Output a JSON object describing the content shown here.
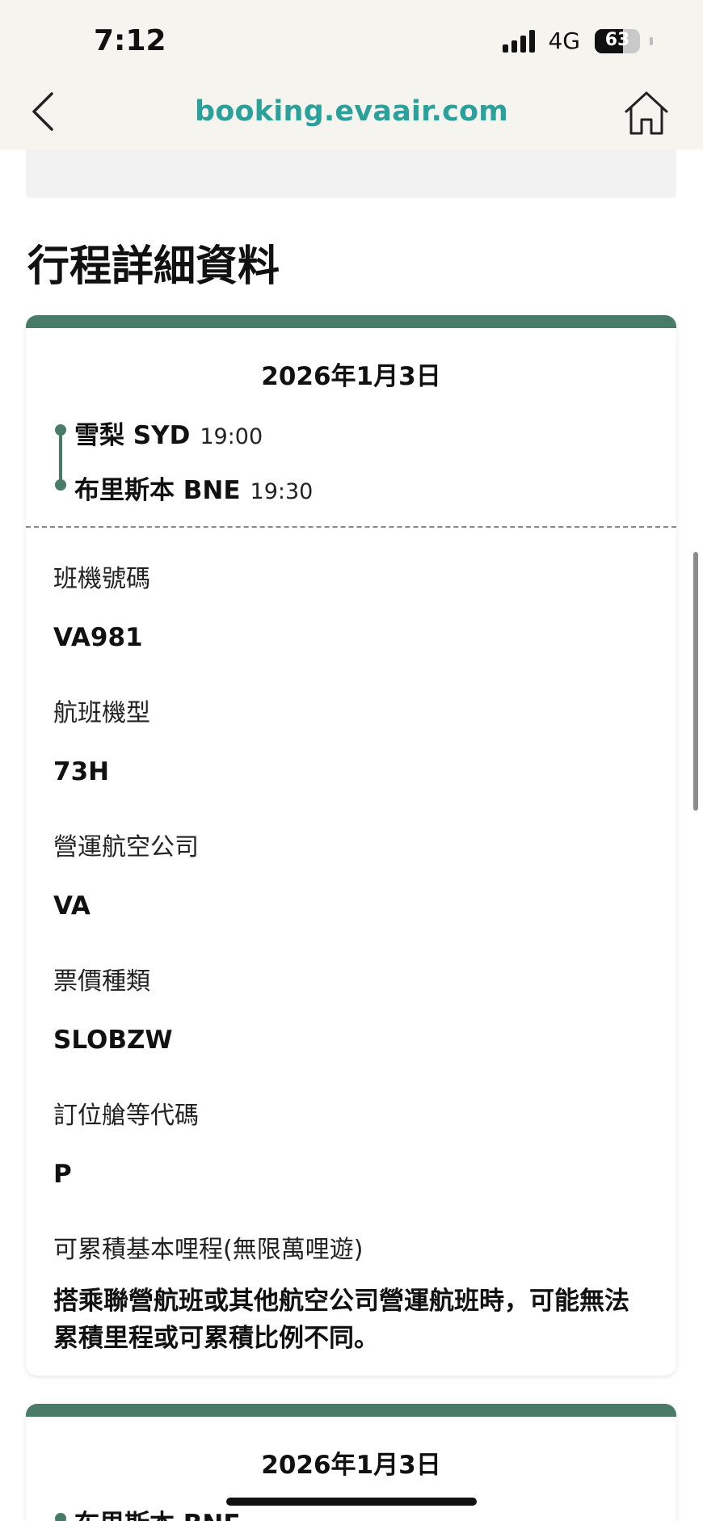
{
  "status_bar": {
    "time": "7:12",
    "network": "4G",
    "battery": "63"
  },
  "browser": {
    "url": "booking.evaair.com"
  },
  "section": {
    "title": "行程詳細資料"
  },
  "colors": {
    "accent": "#4a7a68",
    "url": "#2aa19a"
  },
  "segments": [
    {
      "date": "2026年1月3日",
      "departure": {
        "city": "雪梨 SYD",
        "time": "19:00"
      },
      "arrival": {
        "city": "布里斯本 BNE",
        "time": "19:30"
      },
      "details": [
        {
          "label": "班機號碼",
          "value": "VA981"
        },
        {
          "label": "航班機型",
          "value": "73H"
        },
        {
          "label": "營運航空公司",
          "value": "VA"
        },
        {
          "label": "票價種類",
          "value": "SLOBZW"
        },
        {
          "label": "訂位艙等代碼",
          "value": "P"
        },
        {
          "label": "可累積基本哩程(無限萬哩遊)",
          "value": "搭乘聯營航班或其他航空公司營運航班時，可能無法累積里程或可累積比例不同。"
        }
      ]
    },
    {
      "date": "2026年1月3日",
      "departure": {
        "city": "布里斯本 BNE",
        "time": ""
      }
    }
  ]
}
